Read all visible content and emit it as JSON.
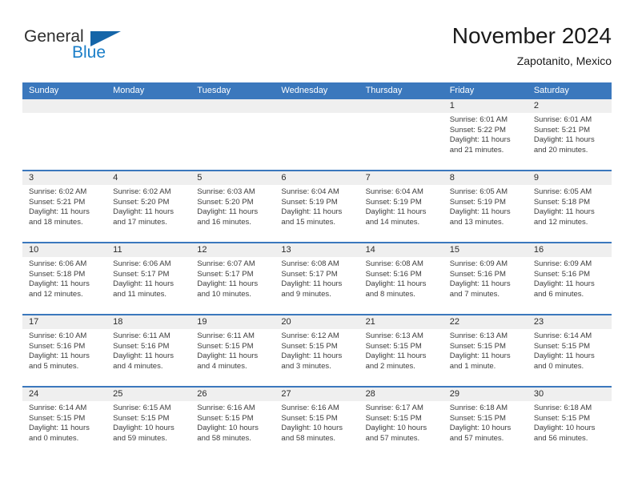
{
  "brand": {
    "word_one": "General",
    "word_two": "Blue"
  },
  "header": {
    "title": "November 2024",
    "subtitle": "Zapotanito, Mexico"
  },
  "calendar": {
    "day_headers": [
      "Sunday",
      "Monday",
      "Tuesday",
      "Wednesday",
      "Thursday",
      "Friday",
      "Saturday"
    ],
    "colors": {
      "header_blue": "#3b78bd",
      "day_band_gray": "#efefef",
      "brand_blue": "#1a7ec8",
      "text": "#3c3c3c"
    },
    "weeks": [
      [
        {
          "day": "",
          "sunrise": "",
          "sunset": "",
          "daylight_line1": "",
          "daylight_line2": ""
        },
        {
          "day": "",
          "sunrise": "",
          "sunset": "",
          "daylight_line1": "",
          "daylight_line2": ""
        },
        {
          "day": "",
          "sunrise": "",
          "sunset": "",
          "daylight_line1": "",
          "daylight_line2": ""
        },
        {
          "day": "",
          "sunrise": "",
          "sunset": "",
          "daylight_line1": "",
          "daylight_line2": ""
        },
        {
          "day": "",
          "sunrise": "",
          "sunset": "",
          "daylight_line1": "",
          "daylight_line2": ""
        },
        {
          "day": "1",
          "sunrise": "Sunrise: 6:01 AM",
          "sunset": "Sunset: 5:22 PM",
          "daylight_line1": "Daylight: 11 hours",
          "daylight_line2": "and 21 minutes."
        },
        {
          "day": "2",
          "sunrise": "Sunrise: 6:01 AM",
          "sunset": "Sunset: 5:21 PM",
          "daylight_line1": "Daylight: 11 hours",
          "daylight_line2": "and 20 minutes."
        }
      ],
      [
        {
          "day": "3",
          "sunrise": "Sunrise: 6:02 AM",
          "sunset": "Sunset: 5:21 PM",
          "daylight_line1": "Daylight: 11 hours",
          "daylight_line2": "and 18 minutes."
        },
        {
          "day": "4",
          "sunrise": "Sunrise: 6:02 AM",
          "sunset": "Sunset: 5:20 PM",
          "daylight_line1": "Daylight: 11 hours",
          "daylight_line2": "and 17 minutes."
        },
        {
          "day": "5",
          "sunrise": "Sunrise: 6:03 AM",
          "sunset": "Sunset: 5:20 PM",
          "daylight_line1": "Daylight: 11 hours",
          "daylight_line2": "and 16 minutes."
        },
        {
          "day": "6",
          "sunrise": "Sunrise: 6:04 AM",
          "sunset": "Sunset: 5:19 PM",
          "daylight_line1": "Daylight: 11 hours",
          "daylight_line2": "and 15 minutes."
        },
        {
          "day": "7",
          "sunrise": "Sunrise: 6:04 AM",
          "sunset": "Sunset: 5:19 PM",
          "daylight_line1": "Daylight: 11 hours",
          "daylight_line2": "and 14 minutes."
        },
        {
          "day": "8",
          "sunrise": "Sunrise: 6:05 AM",
          "sunset": "Sunset: 5:19 PM",
          "daylight_line1": "Daylight: 11 hours",
          "daylight_line2": "and 13 minutes."
        },
        {
          "day": "9",
          "sunrise": "Sunrise: 6:05 AM",
          "sunset": "Sunset: 5:18 PM",
          "daylight_line1": "Daylight: 11 hours",
          "daylight_line2": "and 12 minutes."
        }
      ],
      [
        {
          "day": "10",
          "sunrise": "Sunrise: 6:06 AM",
          "sunset": "Sunset: 5:18 PM",
          "daylight_line1": "Daylight: 11 hours",
          "daylight_line2": "and 12 minutes."
        },
        {
          "day": "11",
          "sunrise": "Sunrise: 6:06 AM",
          "sunset": "Sunset: 5:17 PM",
          "daylight_line1": "Daylight: 11 hours",
          "daylight_line2": "and 11 minutes."
        },
        {
          "day": "12",
          "sunrise": "Sunrise: 6:07 AM",
          "sunset": "Sunset: 5:17 PM",
          "daylight_line1": "Daylight: 11 hours",
          "daylight_line2": "and 10 minutes."
        },
        {
          "day": "13",
          "sunrise": "Sunrise: 6:08 AM",
          "sunset": "Sunset: 5:17 PM",
          "daylight_line1": "Daylight: 11 hours",
          "daylight_line2": "and 9 minutes."
        },
        {
          "day": "14",
          "sunrise": "Sunrise: 6:08 AM",
          "sunset": "Sunset: 5:16 PM",
          "daylight_line1": "Daylight: 11 hours",
          "daylight_line2": "and 8 minutes."
        },
        {
          "day": "15",
          "sunrise": "Sunrise: 6:09 AM",
          "sunset": "Sunset: 5:16 PM",
          "daylight_line1": "Daylight: 11 hours",
          "daylight_line2": "and 7 minutes."
        },
        {
          "day": "16",
          "sunrise": "Sunrise: 6:09 AM",
          "sunset": "Sunset: 5:16 PM",
          "daylight_line1": "Daylight: 11 hours",
          "daylight_line2": "and 6 minutes."
        }
      ],
      [
        {
          "day": "17",
          "sunrise": "Sunrise: 6:10 AM",
          "sunset": "Sunset: 5:16 PM",
          "daylight_line1": "Daylight: 11 hours",
          "daylight_line2": "and 5 minutes."
        },
        {
          "day": "18",
          "sunrise": "Sunrise: 6:11 AM",
          "sunset": "Sunset: 5:16 PM",
          "daylight_line1": "Daylight: 11 hours",
          "daylight_line2": "and 4 minutes."
        },
        {
          "day": "19",
          "sunrise": "Sunrise: 6:11 AM",
          "sunset": "Sunset: 5:15 PM",
          "daylight_line1": "Daylight: 11 hours",
          "daylight_line2": "and 4 minutes."
        },
        {
          "day": "20",
          "sunrise": "Sunrise: 6:12 AM",
          "sunset": "Sunset: 5:15 PM",
          "daylight_line1": "Daylight: 11 hours",
          "daylight_line2": "and 3 minutes."
        },
        {
          "day": "21",
          "sunrise": "Sunrise: 6:13 AM",
          "sunset": "Sunset: 5:15 PM",
          "daylight_line1": "Daylight: 11 hours",
          "daylight_line2": "and 2 minutes."
        },
        {
          "day": "22",
          "sunrise": "Sunrise: 6:13 AM",
          "sunset": "Sunset: 5:15 PM",
          "daylight_line1": "Daylight: 11 hours",
          "daylight_line2": "and 1 minute."
        },
        {
          "day": "23",
          "sunrise": "Sunrise: 6:14 AM",
          "sunset": "Sunset: 5:15 PM",
          "daylight_line1": "Daylight: 11 hours",
          "daylight_line2": "and 0 minutes."
        }
      ],
      [
        {
          "day": "24",
          "sunrise": "Sunrise: 6:14 AM",
          "sunset": "Sunset: 5:15 PM",
          "daylight_line1": "Daylight: 11 hours",
          "daylight_line2": "and 0 minutes."
        },
        {
          "day": "25",
          "sunrise": "Sunrise: 6:15 AM",
          "sunset": "Sunset: 5:15 PM",
          "daylight_line1": "Daylight: 10 hours",
          "daylight_line2": "and 59 minutes."
        },
        {
          "day": "26",
          "sunrise": "Sunrise: 6:16 AM",
          "sunset": "Sunset: 5:15 PM",
          "daylight_line1": "Daylight: 10 hours",
          "daylight_line2": "and 58 minutes."
        },
        {
          "day": "27",
          "sunrise": "Sunrise: 6:16 AM",
          "sunset": "Sunset: 5:15 PM",
          "daylight_line1": "Daylight: 10 hours",
          "daylight_line2": "and 58 minutes."
        },
        {
          "day": "28",
          "sunrise": "Sunrise: 6:17 AM",
          "sunset": "Sunset: 5:15 PM",
          "daylight_line1": "Daylight: 10 hours",
          "daylight_line2": "and 57 minutes."
        },
        {
          "day": "29",
          "sunrise": "Sunrise: 6:18 AM",
          "sunset": "Sunset: 5:15 PM",
          "daylight_line1": "Daylight: 10 hours",
          "daylight_line2": "and 57 minutes."
        },
        {
          "day": "30",
          "sunrise": "Sunrise: 6:18 AM",
          "sunset": "Sunset: 5:15 PM",
          "daylight_line1": "Daylight: 10 hours",
          "daylight_line2": "and 56 minutes."
        }
      ]
    ]
  }
}
